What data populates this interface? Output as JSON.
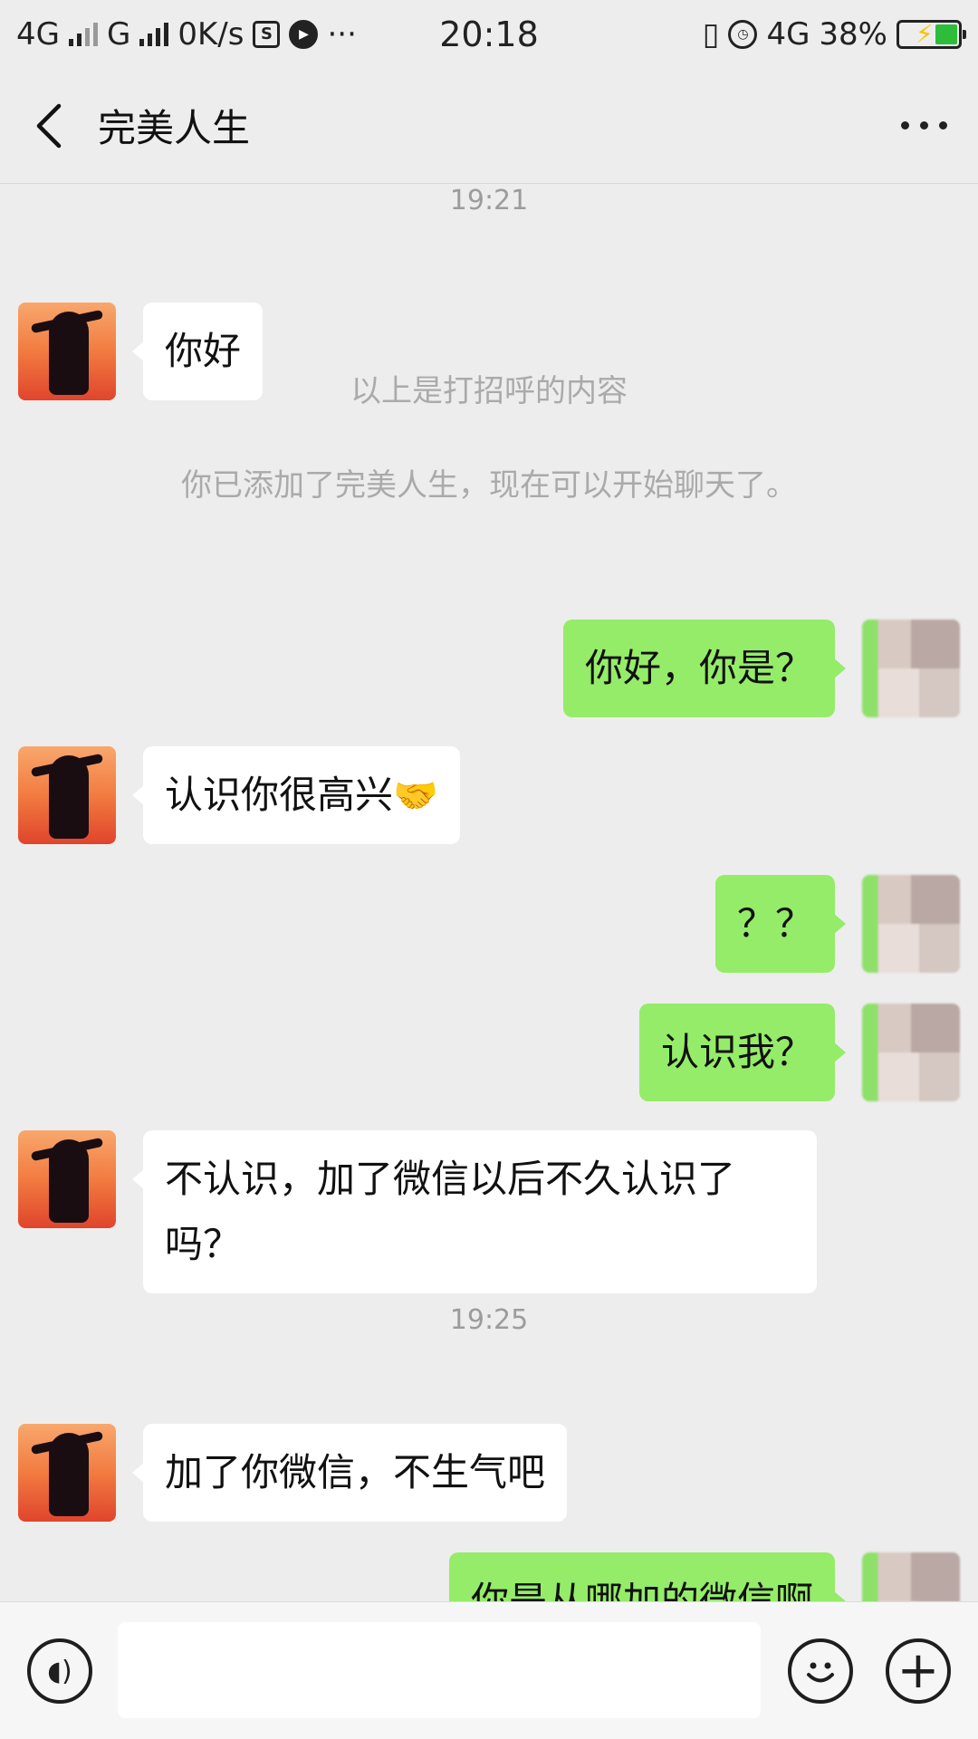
{
  "status_bar": {
    "network1": "4G",
    "network2": "G",
    "speed": "0K/s",
    "time": "20:18",
    "network3": "4G",
    "battery": "38%",
    "battery_level": 0.38
  },
  "header": {
    "title": "完美人生",
    "back_icon": "chevron-left-icon",
    "more_icon": "more-dots-icon"
  },
  "chat": {
    "timestamp1": "19:21",
    "msg1": "你好",
    "system1": "以上是打招呼的内容",
    "system2": "你已添加了完美人生，现在可以开始聊天了。",
    "msg2": "你好，你是？",
    "msg3": "认识你很高兴",
    "msg3_emoji": "🤝",
    "msg4": "？？",
    "msg5": "认识我？",
    "msg6_line1": "不认识，加了微信以后不久认识了",
    "msg6_line2": "吗？",
    "timestamp2": "19:25",
    "msg7": "加了你微信，不生气吧",
    "msg8": "你是从哪加的微信啊"
  },
  "input_bar": {
    "voice_icon": "voice-icon",
    "input_value": "",
    "emoji_icon": "emoji-icon",
    "plus_icon": "plus-icon"
  },
  "colors": {
    "background": "#ededed",
    "self_bubble": "#95ec69",
    "other_bubble": "#ffffff",
    "meta_text": "#9c9c9c"
  }
}
